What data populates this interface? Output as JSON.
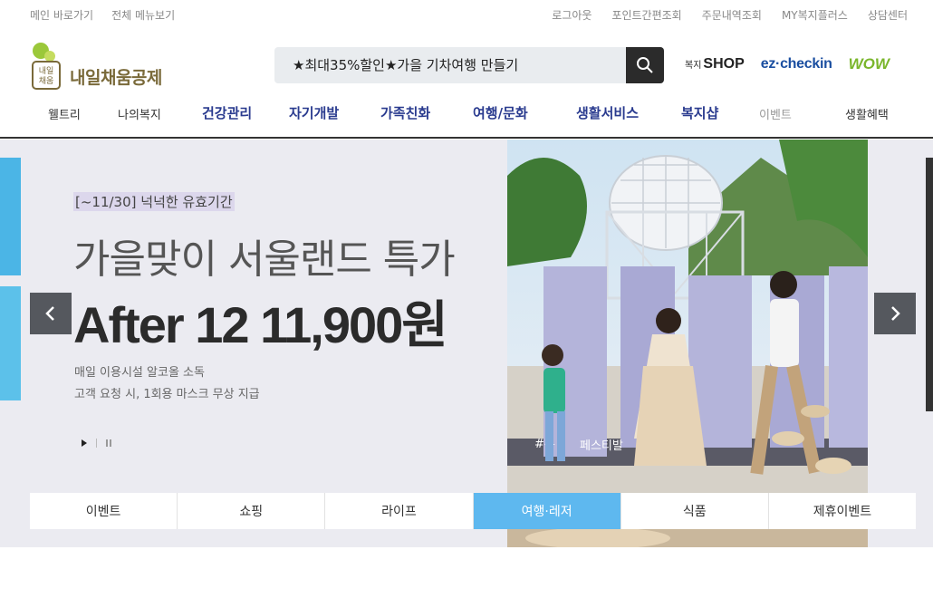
{
  "topbar": {
    "left": [
      "메인 바로가기",
      "전체 메뉴보기"
    ],
    "right": [
      "로그아웃",
      "포인트간편조회",
      "주문내역조회",
      "MY복지플러스",
      "상담센터"
    ]
  },
  "logo": {
    "mark_text": "내일\n채움",
    "text": "내일채움공제"
  },
  "search": {
    "placeholder": "★최대35%할인★가을 기차여행 만들기"
  },
  "partners": {
    "shop_small": "복지",
    "shop": "SHOP",
    "ezcheckin": "ez·checkin",
    "wow": "WOW"
  },
  "nav": [
    "웰트리",
    "나의복지",
    "건강관리",
    "자기개발",
    "가족친화",
    "여행/문화",
    "생활서비스",
    "복지샵",
    "이벤트",
    "생활혜택"
  ],
  "banner": {
    "tag": "[~11/30] 넉넉한 유효기간",
    "title": "가을맞이 서울랜드 특가",
    "price": "After 12 11,900원",
    "desc1": "매일 이용시설 알코올 소독",
    "desc2": "고객 요청 시, 1회용 마스크 무상 지급",
    "photo_caption": "페스티발"
  },
  "tabs": [
    "이벤트",
    "쇼핑",
    "라이프",
    "여행·레저",
    "식품",
    "제휴이벤트"
  ],
  "active_tab": "여행·레저",
  "colors": {
    "nav_blue": "#2a3b8f",
    "tab_active": "#5eb8ef",
    "banner_bg": "#ebebf1"
  }
}
